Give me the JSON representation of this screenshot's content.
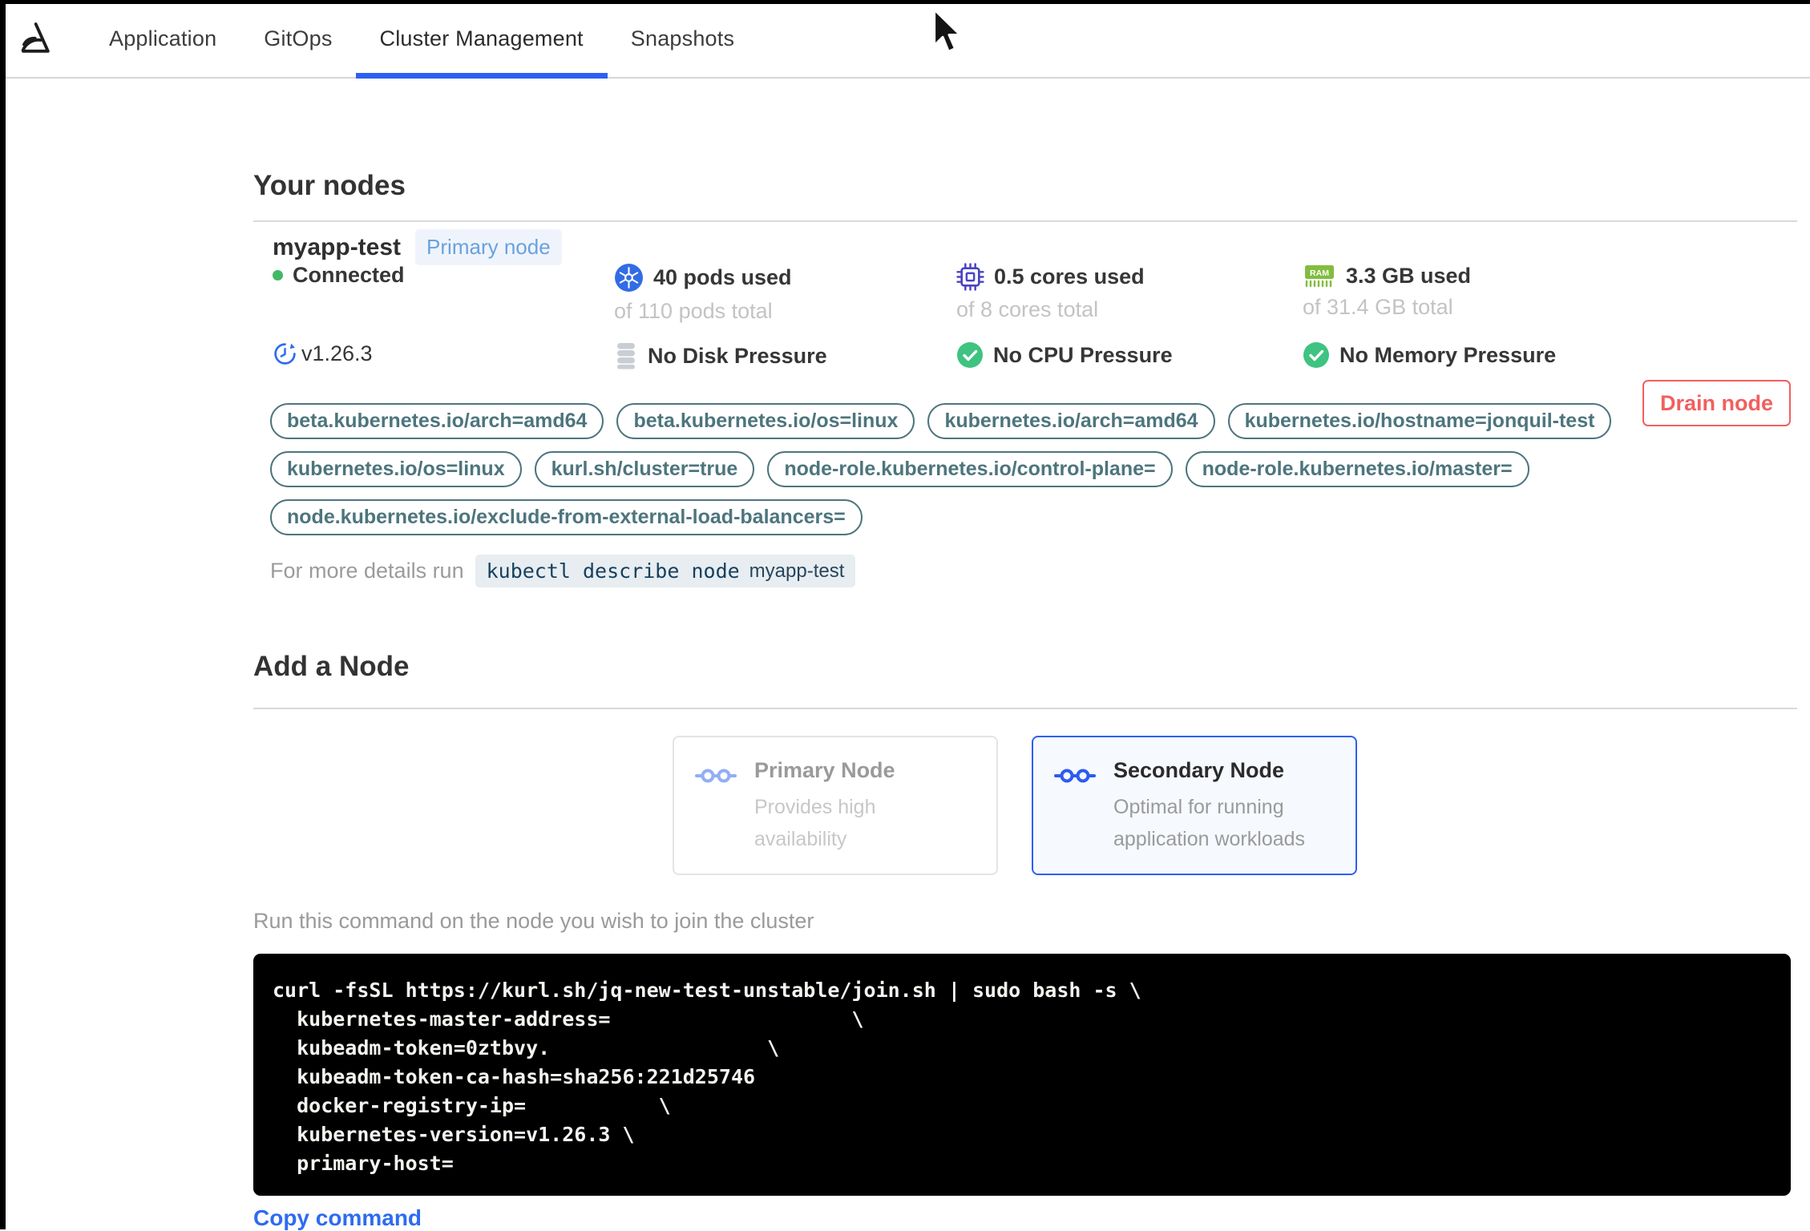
{
  "header": {
    "tabs": [
      {
        "label": "Application"
      },
      {
        "label": "GitOps"
      },
      {
        "label": "Cluster Management"
      },
      {
        "label": "Snapshots"
      }
    ],
    "active_tab": "Cluster Management"
  },
  "your_nodes": {
    "heading": "Your nodes",
    "node": {
      "name": "myapp-test",
      "badge": "Primary node",
      "status": "Connected",
      "version": "v1.26.3",
      "pods": {
        "used": "40 pods used",
        "total": "of 110 pods total"
      },
      "cores": {
        "used": "0.5 cores used",
        "total": "of 8 cores total"
      },
      "memory": {
        "used": "3.3 GB used",
        "total": "of 31.4 GB total"
      },
      "conditions": {
        "disk": "No Disk Pressure",
        "cpu": "No CPU Pressure",
        "memory": "No Memory Pressure"
      },
      "labels_row1": [
        "beta.kubernetes.io/arch=amd64",
        "beta.kubernetes.io/os=linux",
        "kubernetes.io/arch=amd64",
        "kubernetes.io/hostname=jonquil-test"
      ],
      "labels_row2": [
        "kubernetes.io/os=linux",
        "kurl.sh/cluster=true",
        "node-role.kubernetes.io/control-plane=",
        "node-role.kubernetes.io/master="
      ],
      "labels_row3": [
        "node.kubernetes.io/exclude-from-external-load-balancers="
      ],
      "details_prefix": "For more details run",
      "details_code": "kubectl describe node",
      "details_node": "myapp-test",
      "drain_button": "Drain node"
    }
  },
  "add_node": {
    "heading": "Add a Node",
    "cards": [
      {
        "title": "Primary Node",
        "subtitle": "Provides high availability",
        "selected": false
      },
      {
        "title": "Secondary Node",
        "subtitle": "Optimal for running application workloads",
        "selected": true
      }
    ],
    "instruction": "Run this command on the node you wish to join the cluster",
    "copy_label": "Copy command"
  },
  "terminal": {
    "lines": [
      "curl -fsSL https://kurl.sh/jq-new-test-unstable/join.sh | sudo bash -s \\",
      "  kubernetes-master-address=                    \\",
      "  kubeadm-token=0ztbvy.                  \\",
      "  kubeadm-token-ca-hash=sha256:221d25746",
      "  docker-registry-ip=           \\",
      "  kubernetes-version=v1.26.3 \\",
      "  primary-host="
    ]
  },
  "colors": {
    "accent_blue": "#2e5ff2",
    "badge_blue": "#69a2dd",
    "tag_teal": "#4d757d",
    "danger_red": "#f25f5f",
    "success_green": "#3fc380",
    "connected_green": "#41b865",
    "k8s_blue": "#326ce5",
    "cpu_indigo": "#4a43c4",
    "ram_green": "#82bd3f",
    "link_blue": "#2e6bf0",
    "terminal_bg": "#000000"
  }
}
